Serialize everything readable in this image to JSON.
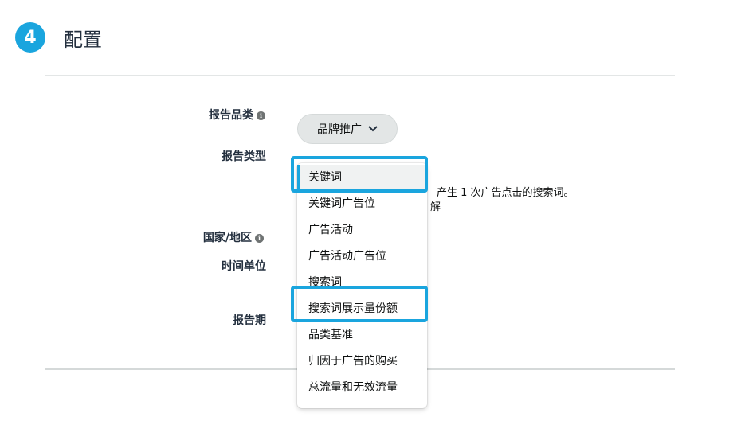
{
  "section": {
    "step_number": "4",
    "title": "配置"
  },
  "labels": {
    "report_category": "报告品类",
    "report_type": "报告类型",
    "country_region": "国家/地区",
    "time_unit": "时间单位",
    "report_period": "报告期"
  },
  "category_select": {
    "value": "品牌推广",
    "chevron": "chevron-down-icon"
  },
  "report_type_desc": {
    "line1": "产生 1 次广告点击的搜索词。",
    "line2": "解"
  },
  "dropdown": {
    "items": [
      {
        "label": "关键词",
        "selected": true
      },
      {
        "label": "关键词广告位"
      },
      {
        "label": "广告活动"
      },
      {
        "label": "广告活动广告位"
      },
      {
        "label": "搜索词"
      },
      {
        "label": "搜索词展示量份额"
      },
      {
        "label": "品类基准"
      },
      {
        "label": "归因于广告的购买"
      },
      {
        "label": "总流量和无效流量"
      }
    ]
  },
  "colors": {
    "accent": "#1aa5de",
    "label": "#232f3e",
    "select_bg": "#e3e6e6"
  }
}
